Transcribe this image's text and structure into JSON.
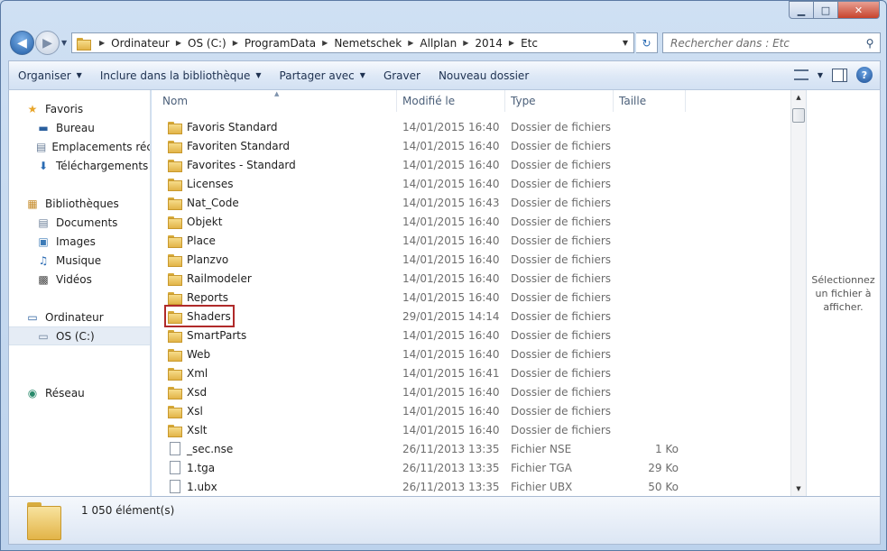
{
  "window": {
    "caption": {
      "minimize": "▁",
      "maximize": "□",
      "close": "✕"
    }
  },
  "nav_buttons": {
    "back_glyph": "◀",
    "forward_glyph": "▶",
    "recent_glyph": "▼"
  },
  "address": {
    "crumbs": [
      "Ordinateur",
      "OS (C:)",
      "ProgramData",
      "Nemetschek",
      "Allplan",
      "2014",
      "Etc"
    ],
    "separator": "▶",
    "dropdown": "▼",
    "refresh_glyph": "↻"
  },
  "search": {
    "placeholder": "Rechercher dans : Etc",
    "icon": "search-icon",
    "glyph": "⚲"
  },
  "toolbar": {
    "organize": "Organiser",
    "include": "Inclure dans la bibliothèque",
    "share": "Partager avec",
    "burn": "Graver",
    "new_folder": "Nouveau dossier",
    "dd": "▼",
    "help": "?"
  },
  "sidebar": {
    "items": [
      {
        "label": "Favoris",
        "icon": "star-icon",
        "glyph": "★",
        "color": "#e8a52a",
        "indent": 0
      },
      {
        "label": "Bureau",
        "icon": "desktop-icon",
        "glyph": "▬",
        "color": "#2a5f9e",
        "indent": 1
      },
      {
        "label": "Emplacements récents",
        "icon": "recent-places-icon",
        "glyph": "▤",
        "color": "#6b7f99",
        "indent": 1
      },
      {
        "label": "Téléchargements",
        "icon": "downloads-icon",
        "glyph": "⬇",
        "color": "#2a6bb3",
        "indent": 1
      },
      {
        "label": "Bibliothèques",
        "icon": "libraries-icon",
        "glyph": "▦",
        "color": "#c58b2a",
        "indent": 0
      },
      {
        "label": "Documents",
        "icon": "documents-icon",
        "glyph": "▤",
        "color": "#6b7f99",
        "indent": 1
      },
      {
        "label": "Images",
        "icon": "images-icon",
        "glyph": "▣",
        "color": "#3c7bb8",
        "indent": 1
      },
      {
        "label": "Musique",
        "icon": "music-icon",
        "glyph": "♫",
        "color": "#2a6bb3",
        "indent": 1
      },
      {
        "label": "Vidéos",
        "icon": "videos-icon",
        "glyph": "▩",
        "color": "#444",
        "indent": 1
      },
      {
        "label": "Ordinateur",
        "icon": "computer-icon",
        "glyph": "▭",
        "color": "#2a5f9e",
        "indent": 0
      },
      {
        "label": "OS (C:)",
        "icon": "drive-icon",
        "glyph": "▭",
        "color": "#6b7f99",
        "indent": 1
      },
      {
        "label": "Réseau",
        "icon": "network-icon",
        "glyph": "◉",
        "color": "#2a8a6b",
        "indent": 0
      }
    ]
  },
  "columns": {
    "name": "Nom",
    "modified": "Modifié le",
    "type": "Type",
    "size": "Taille",
    "sort_glyph": "▲"
  },
  "files": [
    {
      "name": "Favoris Standard",
      "date": "14/01/2015 16:40",
      "type": "Dossier de fichiers",
      "size": "",
      "kind": "folder"
    },
    {
      "name": "Favoriten Standard",
      "date": "14/01/2015 16:40",
      "type": "Dossier de fichiers",
      "size": "",
      "kind": "folder"
    },
    {
      "name": "Favorites - Standard",
      "date": "14/01/2015 16:40",
      "type": "Dossier de fichiers",
      "size": "",
      "kind": "folder"
    },
    {
      "name": "Licenses",
      "date": "14/01/2015 16:40",
      "type": "Dossier de fichiers",
      "size": "",
      "kind": "folder"
    },
    {
      "name": "Nat_Code",
      "date": "14/01/2015 16:43",
      "type": "Dossier de fichiers",
      "size": "",
      "kind": "folder"
    },
    {
      "name": "Objekt",
      "date": "14/01/2015 16:40",
      "type": "Dossier de fichiers",
      "size": "",
      "kind": "folder"
    },
    {
      "name": "Place",
      "date": "14/01/2015 16:40",
      "type": "Dossier de fichiers",
      "size": "",
      "kind": "folder"
    },
    {
      "name": "Planzvo",
      "date": "14/01/2015 16:40",
      "type": "Dossier de fichiers",
      "size": "",
      "kind": "folder"
    },
    {
      "name": "Railmodeler",
      "date": "14/01/2015 16:40",
      "type": "Dossier de fichiers",
      "size": "",
      "kind": "folder"
    },
    {
      "name": "Reports",
      "date": "14/01/2015 16:40",
      "type": "Dossier de fichiers",
      "size": "",
      "kind": "folder"
    },
    {
      "name": "Shaders",
      "date": "29/01/2015 14:14",
      "type": "Dossier de fichiers",
      "size": "",
      "kind": "folder"
    },
    {
      "name": "SmartParts",
      "date": "14/01/2015 16:40",
      "type": "Dossier de fichiers",
      "size": "",
      "kind": "folder"
    },
    {
      "name": "Web",
      "date": "14/01/2015 16:40",
      "type": "Dossier de fichiers",
      "size": "",
      "kind": "folder"
    },
    {
      "name": "Xml",
      "date": "14/01/2015 16:41",
      "type": "Dossier de fichiers",
      "size": "",
      "kind": "folder"
    },
    {
      "name": "Xsd",
      "date": "14/01/2015 16:40",
      "type": "Dossier de fichiers",
      "size": "",
      "kind": "folder"
    },
    {
      "name": "Xsl",
      "date": "14/01/2015 16:40",
      "type": "Dossier de fichiers",
      "size": "",
      "kind": "folder"
    },
    {
      "name": "Xslt",
      "date": "14/01/2015 16:40",
      "type": "Dossier de fichiers",
      "size": "",
      "kind": "folder"
    },
    {
      "name": "_sec.nse",
      "date": "26/11/2013 13:35",
      "type": "Fichier NSE",
      "size": "1 Ko",
      "kind": "file"
    },
    {
      "name": "1.tga",
      "date": "26/11/2013 13:35",
      "type": "Fichier TGA",
      "size": "29 Ko",
      "kind": "file"
    },
    {
      "name": "1.ubx",
      "date": "26/11/2013 13:35",
      "type": "Fichier UBX",
      "size": "50 Ko",
      "kind": "file"
    }
  ],
  "scrollbar": {
    "up": "▲",
    "down": "▼"
  },
  "preview": {
    "text": "Sélectionnez un fichier à afficher."
  },
  "status": {
    "count": "1 050 élément(s)"
  }
}
